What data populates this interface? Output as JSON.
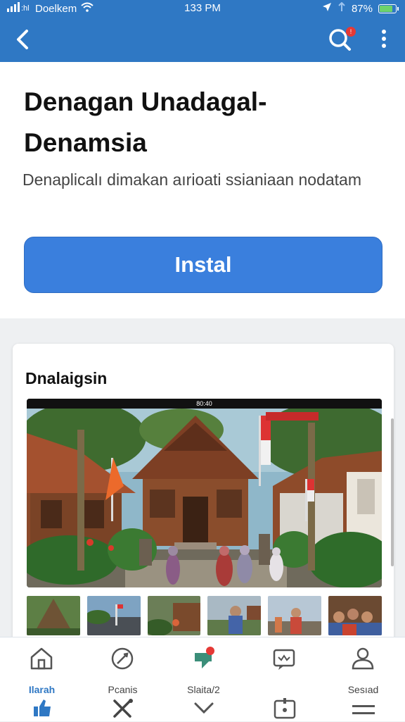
{
  "status_bar": {
    "carrier": "Doelkem",
    "time": "133 PM",
    "battery": "87%",
    "battery_level": 0.87
  },
  "app_bar": {
    "back_icon": "chevron-left-icon",
    "search_icon": "search-icon",
    "search_badge": "!",
    "more_icon": "more-vertical-icon"
  },
  "app": {
    "title": "Denagan Unadagal-Denamsia",
    "description": "Denaplicalı dimakan aırioati ssianiaan nodatam",
    "install_label": "Instal"
  },
  "screenshots": {
    "title": "Dnalaigsin",
    "preview_caption": "80:40",
    "thumb_count_hint": "6"
  },
  "bottom_nav": {
    "items": [
      {
        "label": "Ilarah",
        "icon": "home-icon",
        "sub_icon": "thumbs-up-icon",
        "active": true
      },
      {
        "label": "Pcanis",
        "icon": "compass-icon",
        "sub_icon": "tools-icon",
        "active": false
      },
      {
        "label": "Slaita/2",
        "icon": "chat-icon",
        "sub_icon": "chevron-down-icon",
        "active": false
      },
      {
        "label": "",
        "icon": "message-icon",
        "sub_icon": "calendar-icon",
        "active": false
      },
      {
        "label": "Sesıad",
        "icon": "user-icon",
        "sub_icon": "menu-icon",
        "active": false
      }
    ]
  },
  "colors": {
    "brand": "#2f78c4",
    "install": "#3a7fdd",
    "badge": "#e53935"
  }
}
